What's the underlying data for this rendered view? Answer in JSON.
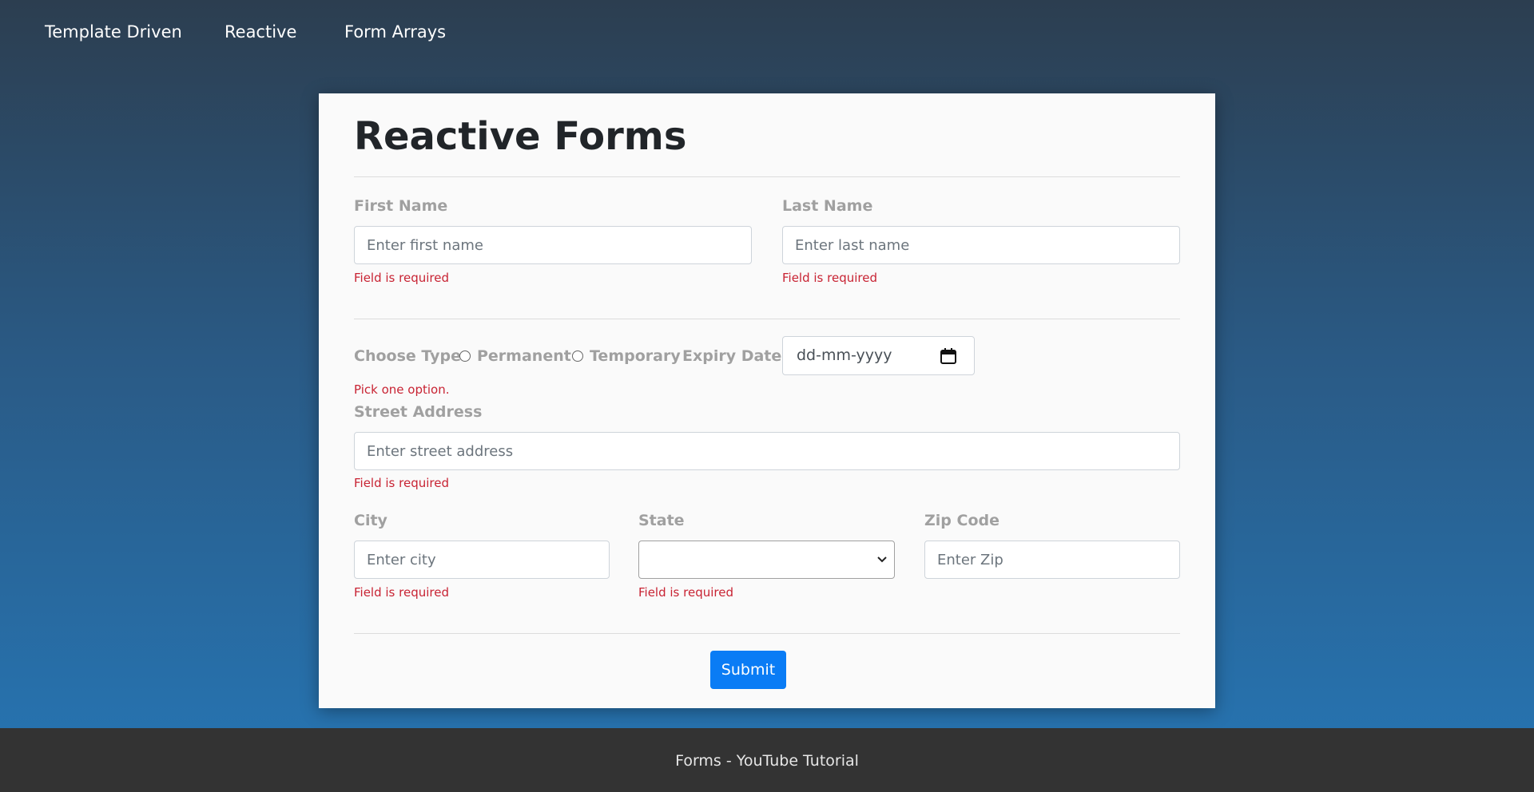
{
  "nav": {
    "items": [
      {
        "label": "Template Driven"
      },
      {
        "label": "Reactive"
      },
      {
        "label": "Form Arrays"
      }
    ]
  },
  "form": {
    "title": "Reactive Forms",
    "first_name": {
      "label": "First Name",
      "placeholder": "Enter first name",
      "error": "Field is required"
    },
    "last_name": {
      "label": "Last Name",
      "placeholder": "Enter last name",
      "error": "Field is required"
    },
    "choose_type": {
      "label": "Choose Type",
      "options": [
        "Permanent",
        "Temporary"
      ],
      "error": "Pick one option."
    },
    "expiry_date": {
      "label": "Expiry Date",
      "placeholder": "dd-mm-yyyy"
    },
    "street": {
      "label": "Street Address",
      "placeholder": "Enter street address",
      "error": "Field is required"
    },
    "city": {
      "label": "City",
      "placeholder": "Enter city",
      "error": "Field is required"
    },
    "state": {
      "label": "State",
      "value": "",
      "error": "Field is required"
    },
    "zip": {
      "label": "Zip Code",
      "placeholder": "Enter Zip"
    },
    "submit_label": "Submit"
  },
  "footer": {
    "text": "Forms - YouTube Tutorial"
  },
  "colors": {
    "primary": "#0a7cf5",
    "error": "#c82333",
    "footer_bg": "#333333"
  }
}
